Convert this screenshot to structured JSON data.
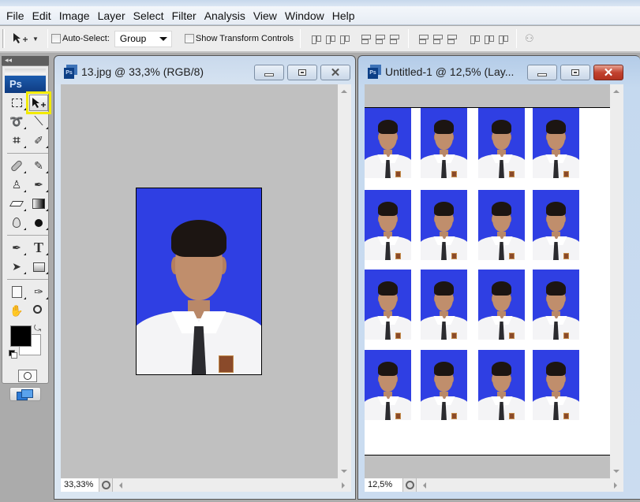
{
  "menu": [
    "File",
    "Edit",
    "Image",
    "Layer",
    "Select",
    "Filter",
    "Analysis",
    "View",
    "Window",
    "Help"
  ],
  "options_bar": {
    "tool": "move-tool",
    "auto_select_label": "Auto-Select:",
    "auto_select_checked": false,
    "auto_select_mode": "Group",
    "show_transform_label": "Show Transform Controls",
    "show_transform_checked": false,
    "align_buttons": [
      "align-top-edges",
      "align-vertical-centers",
      "align-bottom-edges",
      "align-left-edges",
      "align-horizontal-centers",
      "align-right-edges"
    ],
    "distribute_buttons": [
      "distribute-top-edges",
      "distribute-vertical-centers",
      "distribute-bottom-edges",
      "distribute-left-edges",
      "distribute-horizontal-centers",
      "distribute-right-edges"
    ],
    "auto_align_button": "auto-align-layers"
  },
  "toolbox": {
    "collapse_glyph": "◂◂",
    "logo": "Ps",
    "selected_tool": "move-tool",
    "tools": [
      {
        "name": "rectangular-marquee-tool",
        "glyph": "⬚"
      },
      {
        "name": "move-tool",
        "glyph": "▸✥"
      },
      {
        "name": "lasso-tool",
        "glyph": "➰"
      },
      {
        "name": "magic-wand-tool",
        "glyph": "⟋"
      },
      {
        "name": "crop-tool",
        "glyph": "⌗"
      },
      {
        "name": "slice-tool",
        "glyph": "✐"
      },
      {
        "name": "healing-brush-tool",
        "glyph": "✚"
      },
      {
        "name": "brush-tool",
        "glyph": "🖌"
      },
      {
        "name": "clone-stamp-tool",
        "glyph": "⚲"
      },
      {
        "name": "history-brush-tool",
        "glyph": "✎"
      },
      {
        "name": "eraser-tool",
        "glyph": "⌫"
      },
      {
        "name": "gradient-tool",
        "glyph": "▬"
      },
      {
        "name": "blur-tool",
        "glyph": "💧"
      },
      {
        "name": "dodge-tool",
        "glyph": "●"
      },
      {
        "name": "pen-tool",
        "glyph": "✒"
      },
      {
        "name": "type-tool",
        "glyph": "T"
      },
      {
        "name": "path-selection-tool",
        "glyph": "➤"
      },
      {
        "name": "rectangle-tool",
        "glyph": "▭"
      },
      {
        "name": "notes-tool",
        "glyph": "🗒"
      },
      {
        "name": "eyedropper-tool",
        "glyph": "✑"
      },
      {
        "name": "hand-tool",
        "glyph": "✋"
      },
      {
        "name": "zoom-tool",
        "glyph": "🔍"
      }
    ],
    "foreground_color": "#000000",
    "background_color": "#ffffff"
  },
  "windows": [
    {
      "title": "13.jpg @ 33,3% (RGB/8)",
      "zoom": "33,33%",
      "active": false
    },
    {
      "title": "Untitled-1 @ 12,5% (Lay...",
      "zoom": "12,5%",
      "active": true,
      "grid": {
        "rows": 4,
        "cols": 4
      }
    }
  ],
  "colors": {
    "photo_background": "#2f3fe3",
    "canvas_gray": "#c0c0c0",
    "highlight": "#f2ea00"
  }
}
